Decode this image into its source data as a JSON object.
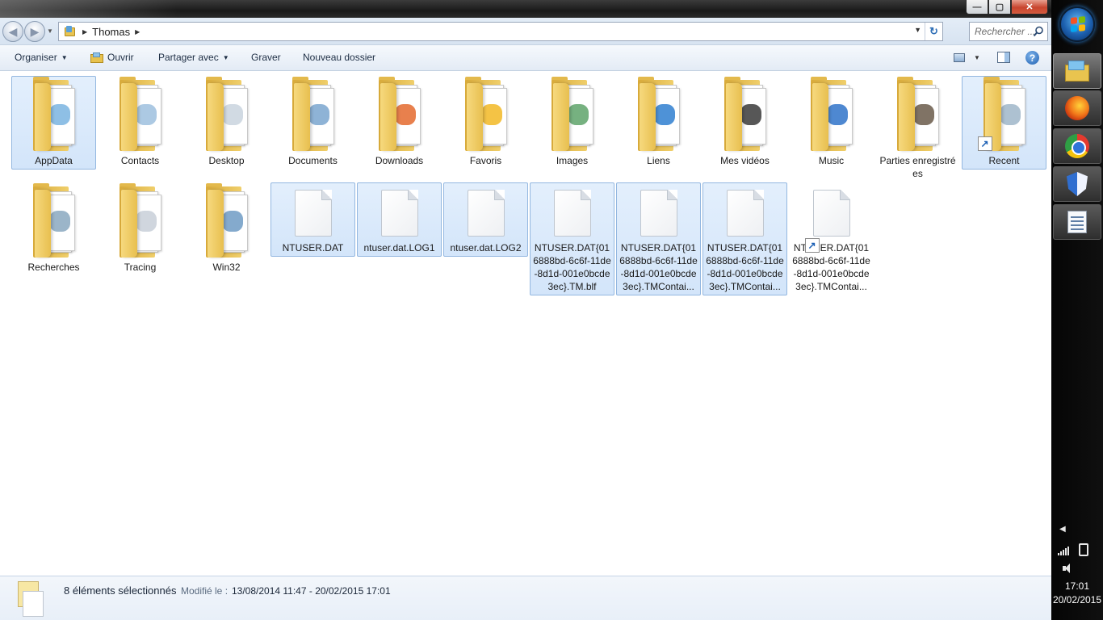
{
  "window": {
    "caption_buttons": {
      "minimize": "—",
      "maximize": "▢",
      "close": "✕"
    }
  },
  "navigation": {
    "breadcrumb": [
      "Thomas"
    ],
    "search_placeholder": "Rechercher ..."
  },
  "toolbar": {
    "organiser": "Organiser",
    "ouvrir": "Ouvrir",
    "partager": "Partager avec",
    "graver": "Graver",
    "nouveau_dossier": "Nouveau dossier"
  },
  "items": [
    {
      "label": "AppData",
      "type": "folder",
      "selected": true
    },
    {
      "label": "Contacts",
      "type": "folder",
      "selected": false
    },
    {
      "label": "Desktop",
      "type": "folder",
      "selected": false
    },
    {
      "label": "Documents",
      "type": "folder",
      "selected": false
    },
    {
      "label": "Downloads",
      "type": "folder",
      "selected": false
    },
    {
      "label": "Favoris",
      "type": "folder",
      "selected": false
    },
    {
      "label": "Images",
      "type": "folder",
      "selected": false
    },
    {
      "label": "Liens",
      "type": "folder",
      "selected": false
    },
    {
      "label": "Mes vidéos",
      "type": "folder",
      "selected": false
    },
    {
      "label": "Music",
      "type": "folder",
      "selected": false
    },
    {
      "label": "Parties enregistrées",
      "type": "folder",
      "selected": false
    },
    {
      "label": "Recent",
      "type": "shortcut-folder",
      "selected": true
    },
    {
      "label": "Recherches",
      "type": "folder",
      "selected": false
    },
    {
      "label": "Tracing",
      "type": "folder",
      "selected": false
    },
    {
      "label": "Win32",
      "type": "folder",
      "selected": false
    },
    {
      "label": "NTUSER.DAT",
      "type": "file",
      "selected": true
    },
    {
      "label": "ntuser.dat.LOG1",
      "type": "file",
      "selected": true
    },
    {
      "label": "ntuser.dat.LOG2",
      "type": "file",
      "selected": true
    },
    {
      "label": "NTUSER.DAT{016888bd-6c6f-11de-8d1d-001e0bcde3ec}.TM.blf",
      "type": "file",
      "selected": true
    },
    {
      "label": "NTUSER.DAT{016888bd-6c6f-11de-8d1d-001e0bcde3ec}.TMContai...",
      "type": "file",
      "selected": true
    },
    {
      "label": "NTUSER.DAT{016888bd-6c6f-11de-8d1d-001e0bcde3ec}.TMContai...",
      "type": "file",
      "selected": true
    },
    {
      "label": "NTUSER.DAT{016888bd-6c6f-11de-8d1d-001e0bcde3ec}.TMContai...",
      "type": "shortcut-file",
      "selected": false
    }
  ],
  "status": {
    "count": "8 éléments sélectionnés",
    "modified_label": "Modifié le :",
    "modified_value": "13/08/2014 11:47 - 20/02/2015 17:01"
  },
  "taskbar": {
    "apps": [
      "explorer-icon",
      "firefox-icon",
      "chrome-icon",
      "security-icon",
      "notepad-icon"
    ],
    "time": "17:01",
    "date": "20/02/2015"
  },
  "colors": {
    "selection_fill": "#d9e8fb",
    "selection_border": "#93b7e0",
    "folder": "#f0cf6b"
  }
}
